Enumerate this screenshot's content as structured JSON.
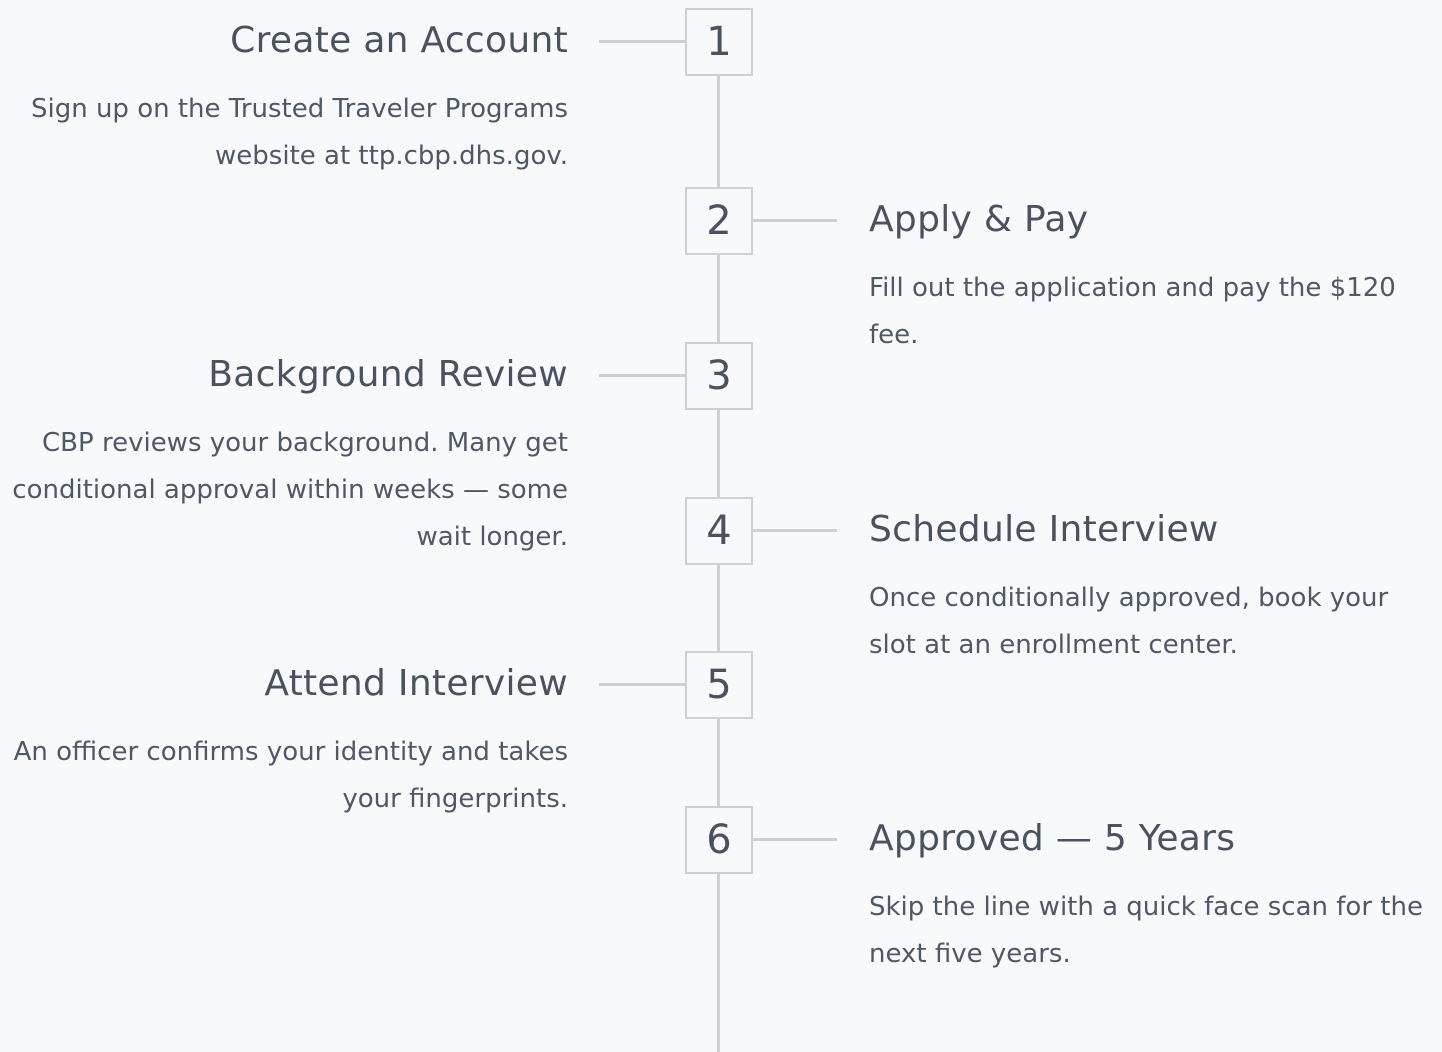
{
  "steps": [
    {
      "number": "1",
      "side": "left",
      "title": "Create an Account",
      "description": "Sign up on the Trusted Traveler Programs website at ttp.cbp.dhs.gov."
    },
    {
      "number": "2",
      "side": "right",
      "title": "Apply & Pay",
      "description": "Fill out the application and pay the $120 fee."
    },
    {
      "number": "3",
      "side": "left",
      "title": "Background Review",
      "description": "CBP reviews your background. Many get conditional approval within weeks — some wait longer."
    },
    {
      "number": "4",
      "side": "right",
      "title": "Schedule Interview",
      "description": "Once conditionally approved, book your slot at an enrollment center."
    },
    {
      "number": "5",
      "side": "left",
      "title": "Attend Interview",
      "description": "An officer confirms your identity and takes your fingerprints."
    },
    {
      "number": "6",
      "side": "right",
      "title": "Approved — 5 Years",
      "description": "Skip the line with a quick face scan for the next five years."
    }
  ]
}
